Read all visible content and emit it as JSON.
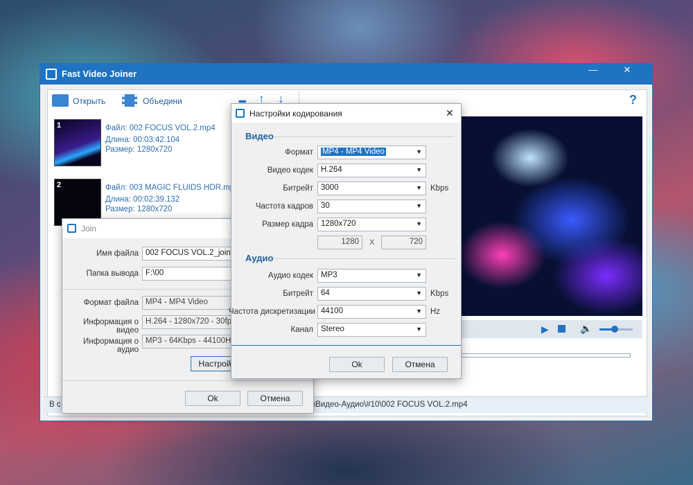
{
  "main": {
    "title": "Fast Video Joiner",
    "minimize": "—",
    "close": "✕",
    "toolbar": {
      "open": "Открыть",
      "join": "Объедини",
      "help": "?"
    },
    "files": [
      {
        "num": "1",
        "name": "Файл: 002 FOCUS VOL.2.mp4",
        "duration": "Длина: 00:03:42.104",
        "size": "Размер: 1280x720"
      },
      {
        "num": "2",
        "name": "Файл: 003 MAGIC FLUIDS HDR.mp4",
        "duration": "Длина: 00:02:39.132",
        "size": "Размер: 1280x720"
      }
    ],
    "status_left": "В с",
    "status_path": "\\Видео-Аудио\\#10\\002 FOCUS VOL.2.mp4"
  },
  "join": {
    "title": "Join",
    "filename_label": "Имя файла",
    "filename_value": "002 FOCUS VOL.2_join",
    "folder_label": "Папка вывода",
    "folder_value": "F:\\00",
    "format_label": "Формат файла",
    "format_value": "MP4 - MP4 Video",
    "video_info_label": "Информация о видео",
    "video_info_value": "H.264 - 1280x720 - 30fps",
    "audio_info_label": "Информация о аудио",
    "audio_info_value": "MP3 - 64Kbps - 44100Hz -",
    "settings_button": "Настрой",
    "ok": "Ok",
    "cancel": "Отмена"
  },
  "encode": {
    "title": "Настройки кодирования",
    "close": "✕",
    "video_section": "Видео",
    "audio_section": "Аудио",
    "format_label": "Формат",
    "format_value": "MP4 - MP4 Video",
    "vcodec_label": "Видео кодек",
    "vcodec_value": "H.264",
    "vbitrate_label": "Битрейт",
    "vbitrate_value": "3000",
    "vbitrate_unit": "Kbps",
    "fps_label": "Частота кадров",
    "fps_value": "30",
    "size_label": "Размер кадра",
    "size_value": "1280x720",
    "width_value": "1280",
    "x_sep": "X",
    "height_value": "720",
    "acodec_label": "Аудио кодек",
    "acodec_value": "MP3",
    "abitrate_label": "Битрейт",
    "abitrate_value": "64",
    "abitrate_unit": "Kbps",
    "rate_label": "Частота дискретизации",
    "rate_value": "44100",
    "rate_unit": "Hz",
    "channel_label": "Канал",
    "channel_value": "Stereo",
    "ok": "Ok",
    "cancel": "Отмена"
  },
  "player": {
    "progress": 0.0,
    "volume": 0.45
  }
}
